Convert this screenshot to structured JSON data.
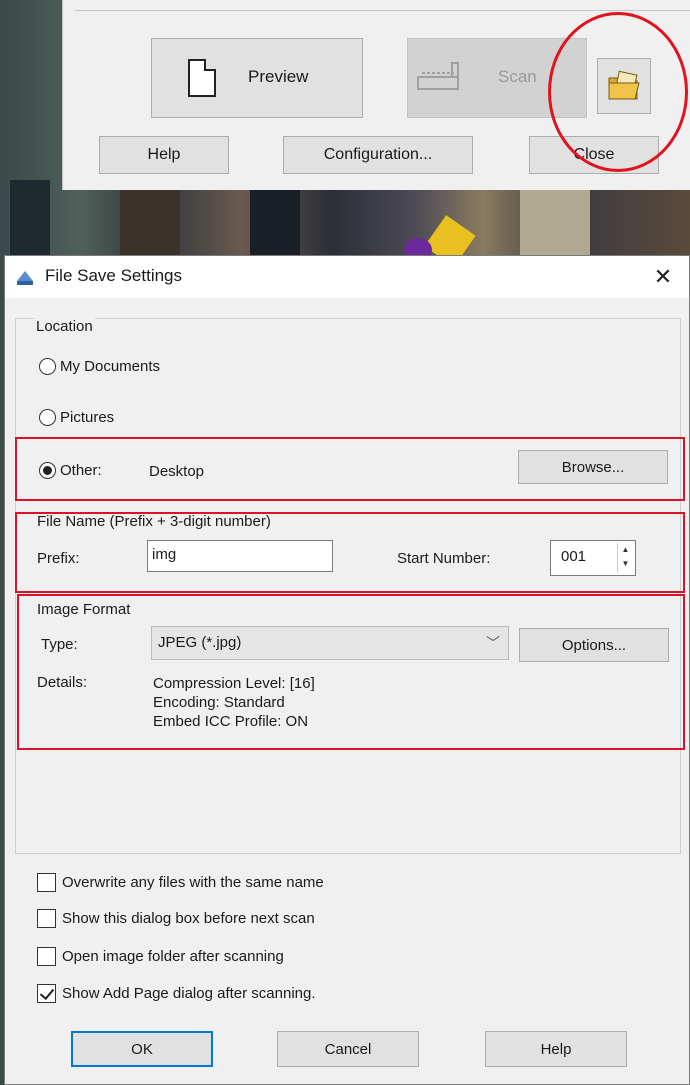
{
  "scanner_window": {
    "preview_label": "Preview",
    "scan_label": "Scan",
    "help_label": "Help",
    "configuration_label": "Configuration...",
    "close_label": "Close",
    "folder_icon": "folder-image-icon"
  },
  "dialog": {
    "title": "File Save Settings",
    "close_icon": "close-icon",
    "location": {
      "group_label": "Location",
      "options": [
        "My Documents",
        "Pictures",
        "Other:"
      ],
      "selected": "Other:",
      "other_value": "Desktop",
      "browse_label": "Browse..."
    },
    "file_name": {
      "group_label": "File Name (Prefix + 3-digit number)",
      "prefix_label": "Prefix:",
      "prefix_value": "img",
      "start_number_label": "Start Number:",
      "start_number_value": "001"
    },
    "image_format": {
      "group_label": "Image Format",
      "type_label": "Type:",
      "type_value": "JPEG (*.jpg)",
      "options_label": "Options...",
      "details_label": "Details:",
      "details_lines": [
        "Compression Level: [16]",
        "Encoding: Standard",
        "Embed ICC Profile: ON"
      ]
    },
    "checkboxes": [
      {
        "label": "Overwrite any files with the same name",
        "checked": false
      },
      {
        "label": "Show this dialog box before next scan",
        "checked": false
      },
      {
        "label": "Open image folder after scanning",
        "checked": false
      },
      {
        "label": "Show Add Page dialog after scanning.",
        "checked": true
      }
    ],
    "buttons": {
      "ok": "OK",
      "cancel": "Cancel",
      "help": "Help"
    }
  },
  "colors": {
    "annotation_red": "#e0141e",
    "dialog_bg": "#f0f0f0",
    "button_bg": "#e1e1e1",
    "focus_blue": "#0078d7"
  }
}
